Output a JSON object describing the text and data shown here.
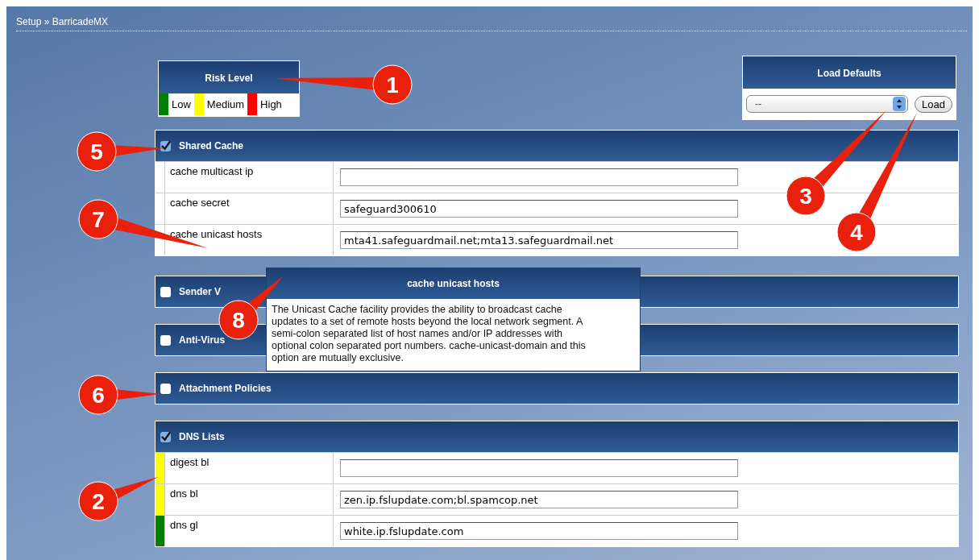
{
  "breadcrumb": "Setup » BarricadeMX",
  "risk_level": {
    "title": "Risk Level",
    "levels": [
      {
        "label": "Low",
        "color": "#008000"
      },
      {
        "label": "Medium",
        "color": "#ffff00"
      },
      {
        "label": "High",
        "color": "#ff0000"
      }
    ]
  },
  "load_defaults": {
    "title": "Load Defaults",
    "select_value": "--",
    "button": "Load"
  },
  "sections": [
    {
      "title": "Shared Cache",
      "checked": true,
      "rows": [
        {
          "label": "cache multicast ip",
          "value": ""
        },
        {
          "label": "cache secret",
          "value": "safeguard300610"
        },
        {
          "label": "cache unicast hosts",
          "value": "mta41.safeguardmail.net;mta13.safeguardmail.net"
        }
      ]
    },
    {
      "title": "Sender V",
      "checked": false
    },
    {
      "title": "Anti-Virus",
      "checked": false
    },
    {
      "title": "Attachment Policies",
      "checked": false
    },
    {
      "title": "DNS Lists",
      "checked": true,
      "rows": [
        {
          "label": "digest bl",
          "value": "",
          "color": "#ffff00"
        },
        {
          "label": "dns bl",
          "value": "zen.ip.fslupdate.com;bl.spamcop.net",
          "color": "#ffff00"
        },
        {
          "label": "dns gl",
          "value": "white.ip.fslupdate.com",
          "color": "#008000"
        }
      ]
    }
  ],
  "tooltip": {
    "title": "cache unicast hosts",
    "text": "The Unicast Cache facility provides the ability to broadcast cache updates to a set of remote hosts beyond the local network segment. A semi-colon separated list of host names and/or IP addresses with optional colon separated port numbers. cache-unicast-domain and this option are mutually exclusive."
  },
  "callouts": [
    "1",
    "5",
    "3",
    "7",
    "4",
    "8",
    "6",
    "2"
  ]
}
